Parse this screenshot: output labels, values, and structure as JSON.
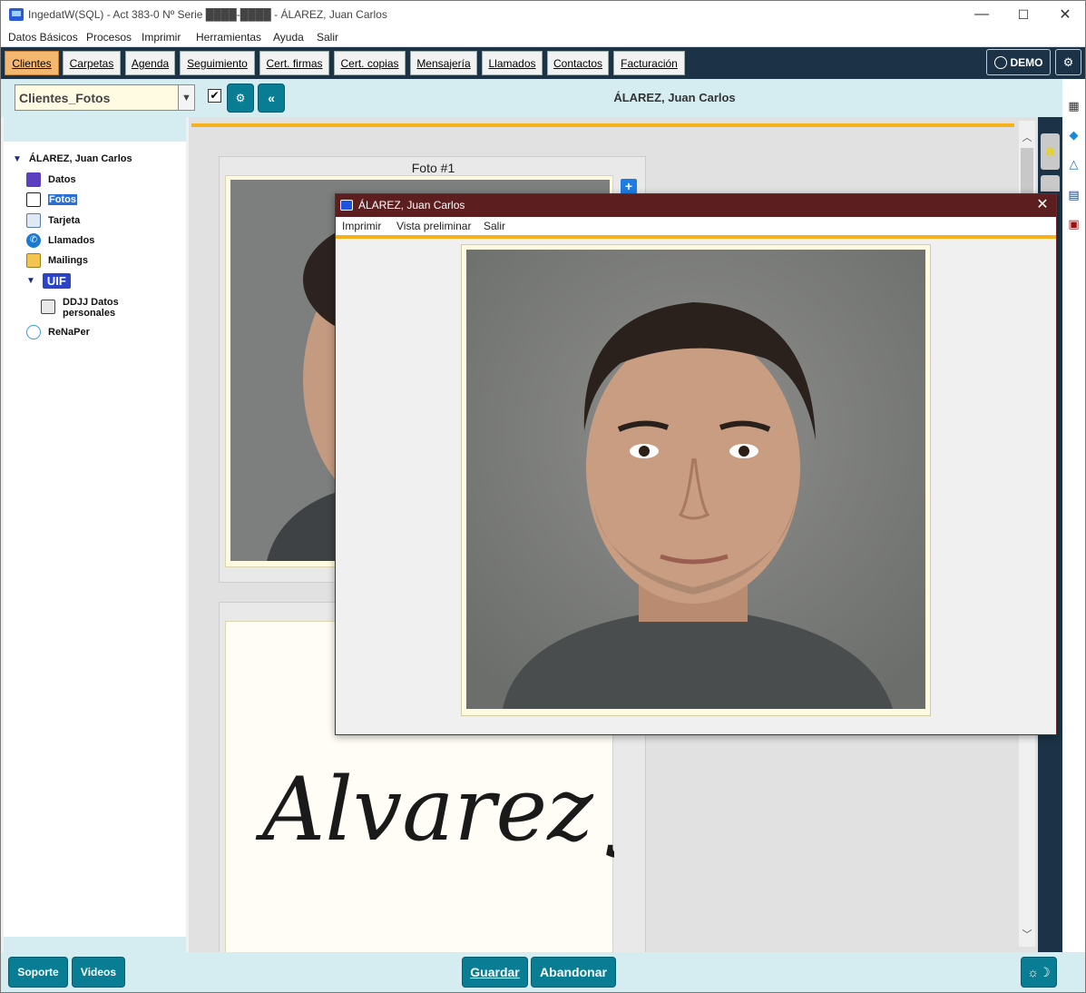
{
  "window": {
    "title": "IngedatW(SQL) - Act 383-0 Nº Serie ████-████ - ÁLAREZ, Juan Carlos",
    "minimize": "—",
    "maximize": "☐",
    "close": "✕"
  },
  "menubar": [
    "Datos Básicos",
    "Procesos",
    "Imprimir",
    "Herramientas",
    "Ayuda",
    "Salir"
  ],
  "tabs": [
    "Clientes",
    "Carpetas",
    "Agenda",
    "Seguimiento",
    "Cert. firmas",
    "Cert. copias",
    "Mensajería",
    "Llamados",
    "Contactos",
    "Facturación"
  ],
  "active_tab": "Clientes",
  "user": {
    "label": "DEMO"
  },
  "toolbar": {
    "view_select": "Clientes_Fotos",
    "checkbox_checked": "✔",
    "gear_btn": "⚙",
    "collapse_btn": "«",
    "client_name": "ÁLAREZ, Juan Carlos"
  },
  "tree": {
    "root": "ÁLAREZ, Juan Carlos",
    "items": [
      "Datos",
      "Fotos",
      "Tarjeta",
      "Llamados",
      "Mailings"
    ],
    "uif": {
      "label": "UIF",
      "children": [
        "DDJJ Datos personales"
      ]
    },
    "renaper": "ReNaPer"
  },
  "content": {
    "photo_label": "Foto #1",
    "add_button": "+",
    "signature_text": "Alvarez J."
  },
  "bottom": {
    "soporte": "Soporte",
    "videos": "Videos",
    "guardar": "Guardar",
    "abandonar": "Abandonar"
  },
  "modal": {
    "title": "ÁLAREZ, Juan Carlos",
    "close": "✕",
    "menu": [
      "Imprimir",
      "Vista preliminar",
      "Salir"
    ]
  }
}
